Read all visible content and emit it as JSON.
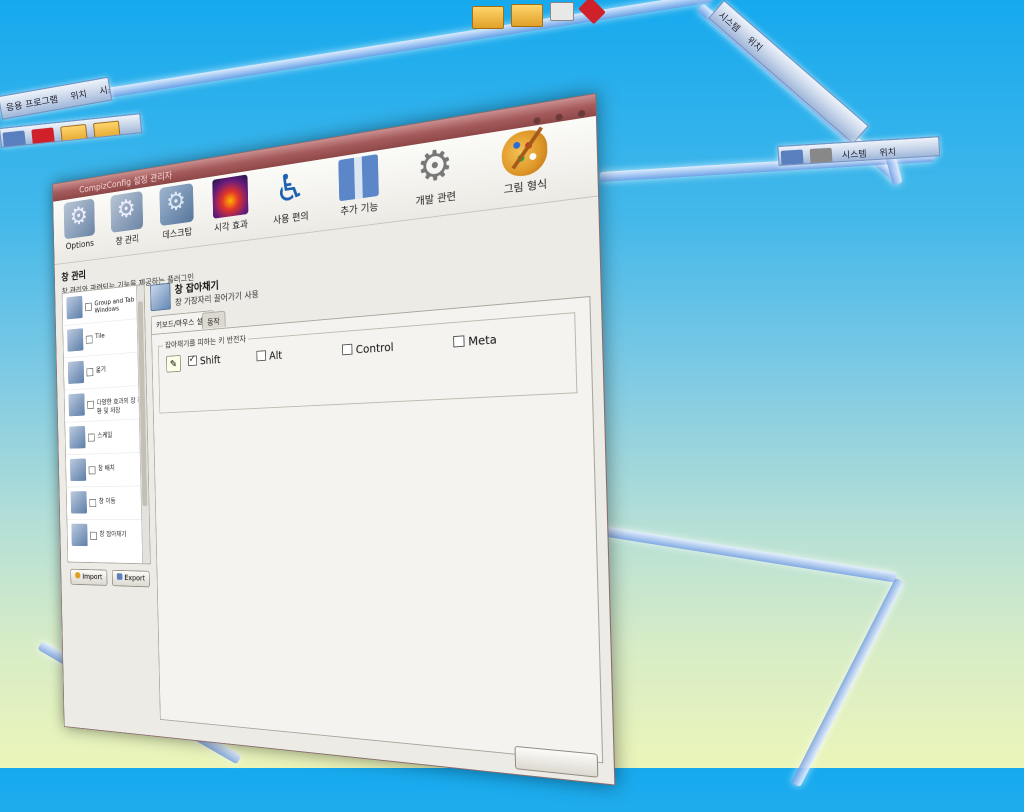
{
  "top_panel": {
    "menu_items": [
      "응용 프로그램",
      "위치",
      "시스템"
    ],
    "right_items": [
      "시스템",
      "위치",
      "응용 프로그램"
    ]
  },
  "window": {
    "title": "CompizConfig 설정 관리자",
    "toolbar": [
      {
        "label": "Options",
        "icon": "options-icon"
      },
      {
        "label": "창 관리",
        "icon": "window-management-icon"
      },
      {
        "label": "데스크탑",
        "icon": "desktop-icon"
      },
      {
        "label": "시각 효과",
        "icon": "visual-effects-icon"
      },
      {
        "label": "사용 편의",
        "icon": "accessibility-icon"
      },
      {
        "label": "추가 기능",
        "icon": "extras-icon"
      },
      {
        "label": "개발 관련",
        "icon": "development-icon"
      },
      {
        "label": "그림 형식",
        "icon": "image-format-icon"
      }
    ],
    "section": {
      "title": "창 관리",
      "description": "창 관리와 관련되는 기능을 제공하는 플러그인"
    },
    "plugin_list": [
      {
        "label": "Group and Tab Windows"
      },
      {
        "label": "Tile"
      },
      {
        "label": "옮기"
      },
      {
        "label": "다양한 효과의 창 전환 및 저장"
      },
      {
        "label": "스케일"
      },
      {
        "label": "창 배치"
      },
      {
        "label": "창 이동"
      },
      {
        "label": "창 잡아채기"
      }
    ],
    "buttons": {
      "import": "Import",
      "export": "Export"
    },
    "plugin": {
      "title": "창 잡아채기",
      "description": "창 가장자리 끌어가기 사용"
    },
    "tabs": [
      "키보드/마우스 설정",
      "동작"
    ],
    "group": {
      "label": "잡아채기를 피하는 키 반전자",
      "modifiers": [
        {
          "label": "Shift",
          "checked": true
        },
        {
          "label": "Alt",
          "checked": false
        },
        {
          "label": "Control",
          "checked": false
        },
        {
          "label": "Meta",
          "checked": false
        }
      ]
    }
  }
}
